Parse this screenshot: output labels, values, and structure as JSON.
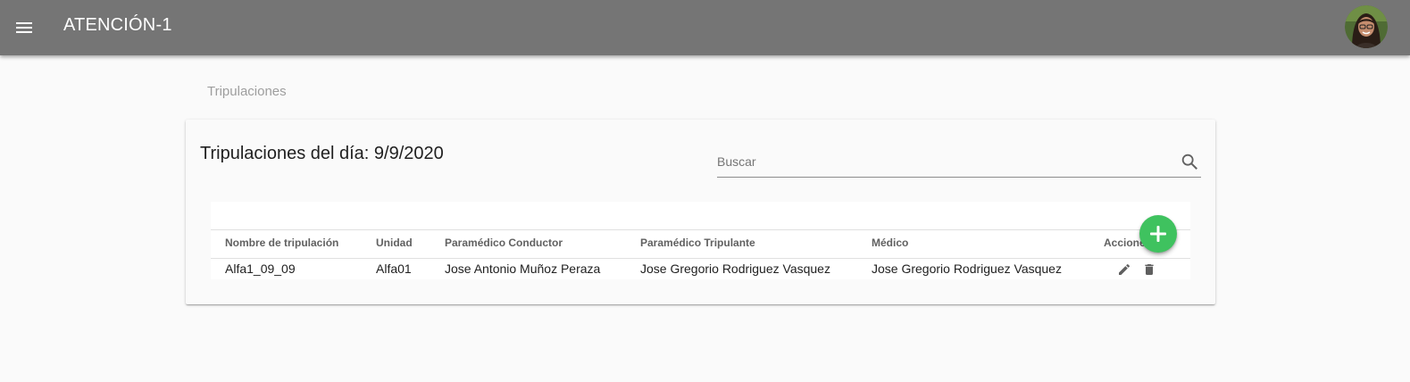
{
  "app": {
    "title": "ATENCIÓN-1",
    "menu_icon": "menu-icon",
    "avatar_icon": "user-avatar"
  },
  "breadcrumb": "Tripulaciones",
  "card": {
    "title": "Tripulaciones del día: 9/9/2020"
  },
  "search": {
    "placeholder": "Buscar",
    "value": "",
    "icon": "search-icon"
  },
  "table": {
    "columns": [
      "Nombre de tripulación",
      "Unidad",
      "Paramédico Conductor",
      "Paramédico Tripulante",
      "Médico",
      "Acciones"
    ],
    "rows": [
      {
        "cells": [
          "Alfa1_09_09",
          "Alfa01",
          "Jose Antonio Muñoz Peraza",
          "Jose Gregorio Rodriguez Vasquez",
          "Jose Gregorio Rodriguez Vasquez"
        ],
        "actions": [
          "edit-icon",
          "delete-icon"
        ]
      }
    ]
  },
  "fab": {
    "icon": "add-icon",
    "color": "#3fc25f"
  },
  "colors": {
    "appbar": "#757575",
    "background": "#fafafa",
    "accent": "#3fc25f"
  }
}
